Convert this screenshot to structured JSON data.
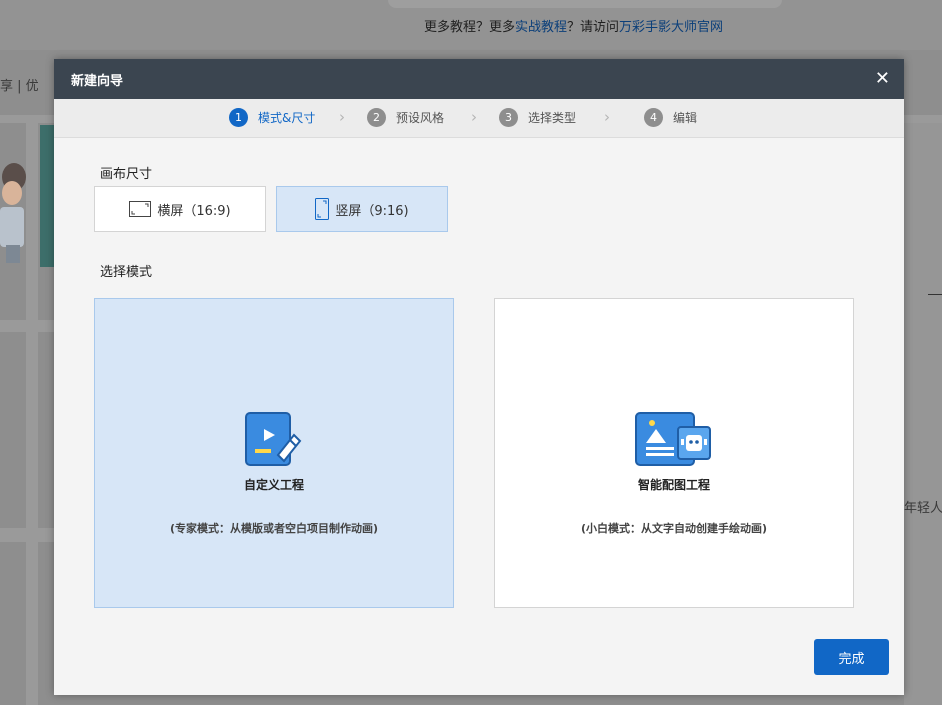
{
  "background": {
    "promo": {
      "text1": "更多教程？更多",
      "link1": "实战教程",
      "text2": "？请访问",
      "link2": "万彩手影大师官网"
    },
    "nav_text": "享 | 优",
    "right_text": "年轻人"
  },
  "dialog": {
    "title": "新建向导",
    "close_icon": "✕",
    "steps": [
      {
        "num": "1",
        "label": "模式&尺寸",
        "active": true
      },
      {
        "num": "2",
        "label": "预设风格",
        "active": false
      },
      {
        "num": "3",
        "label": "选择类型",
        "active": false
      },
      {
        "num": "4",
        "label": "编辑",
        "active": false
      }
    ],
    "chevron": "›",
    "canvas_size_label": "画布尺寸",
    "sizes": [
      {
        "label": "横屏（16:9)",
        "icon": "landscape-icon",
        "selected": false
      },
      {
        "label": "竖屏（9:16)",
        "icon": "portrait-icon",
        "selected": true
      }
    ],
    "mode_label": "选择模式",
    "modes": [
      {
        "title": "自定义工程",
        "desc": "(专家模式：从模版或者空白项目制作动画)",
        "icon": "custom-project-icon",
        "selected": true
      },
      {
        "title": "智能配图工程",
        "desc": "(小白模式：从文字自动创建手绘动画)",
        "icon": "smart-image-icon",
        "selected": false
      }
    ],
    "done_label": "完成"
  },
  "colors": {
    "accent": "#1167c6",
    "selected_bg": "#d7e6f7",
    "title_bar": "#3b4550"
  }
}
